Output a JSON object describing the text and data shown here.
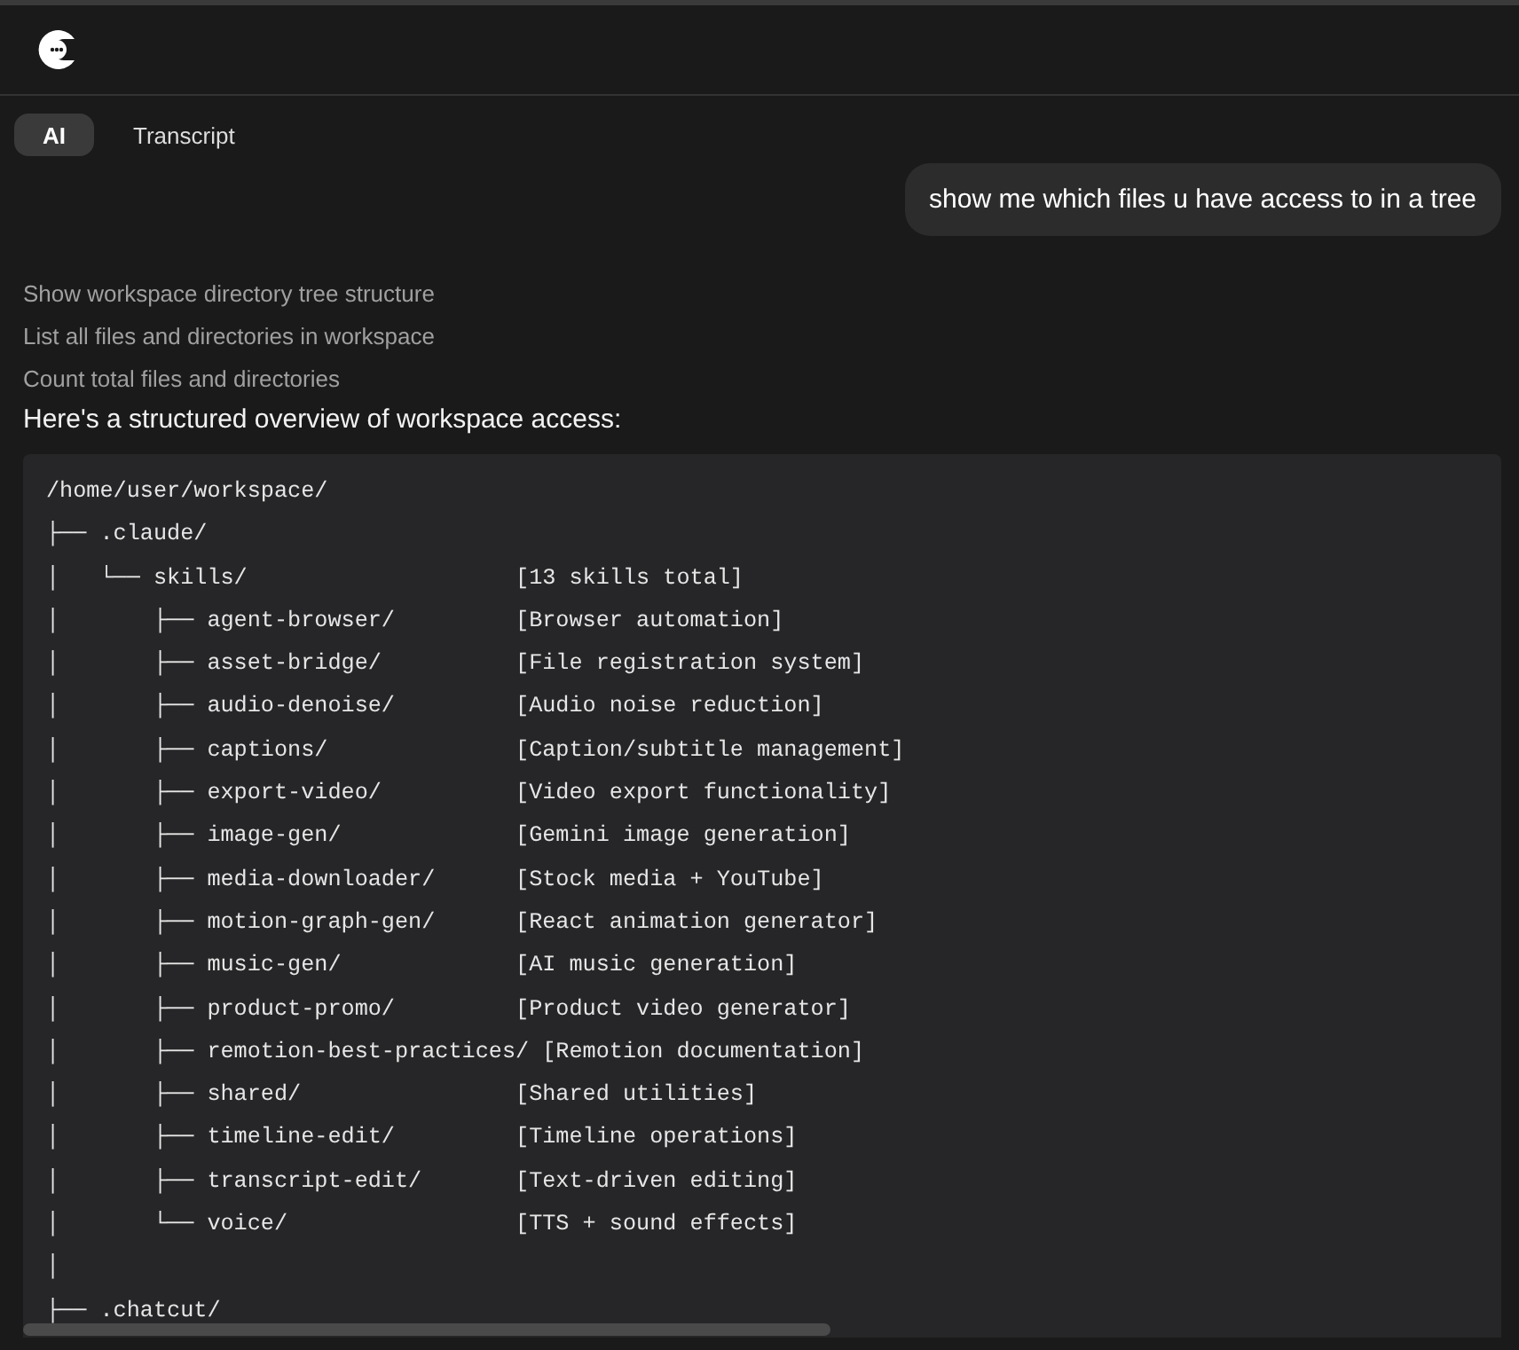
{
  "tabs": [
    {
      "label": "AI",
      "selected": true
    },
    {
      "label": "Transcript",
      "selected": false
    }
  ],
  "user_message": "show me which files u have access to in a tree",
  "tool_steps": [
    "Show workspace directory tree structure",
    "List all files and directories in workspace",
    "Count total files and directories"
  ],
  "response_heading": "Here's a structured overview of workspace access:",
  "code_lines": [
    "/home/user/workspace/",
    "├── .claude/",
    "│   └── skills/                    [13 skills total]",
    "│       ├── agent-browser/         [Browser automation]",
    "│       ├── asset-bridge/          [File registration system]",
    "│       ├── audio-denoise/         [Audio noise reduction]",
    "│       ├── captions/              [Caption/subtitle management]",
    "│       ├── export-video/          [Video export functionality]",
    "│       ├── image-gen/             [Gemini image generation]",
    "│       ├── media-downloader/      [Stock media + YouTube]",
    "│       ├── motion-graph-gen/      [React animation generator]",
    "│       ├── music-gen/             [AI music generation]",
    "│       ├── product-promo/         [Product video generator]",
    "│       ├── remotion-best-practices/ [Remotion documentation]",
    "│       ├── shared/                [Shared utilities]",
    "│       ├── timeline-edit/         [Timeline operations]",
    "│       ├── transcript-edit/       [Text-driven editing]",
    "│       └── voice/                 [TTS + sound effects]",
    "│",
    "├── .chatcut/"
  ]
}
